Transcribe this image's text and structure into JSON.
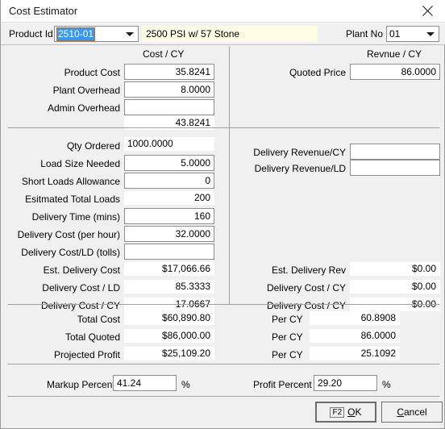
{
  "window": {
    "title": "Cost Estimator",
    "close_icon": "close-icon"
  },
  "selector": {
    "product_id_label": "Product Id",
    "product_id_value": "2510-01",
    "product_description": "2500 PSI w/ 57 Stone",
    "plant_no_label": "Plant No",
    "plant_no_value": "01",
    "dropdown_icon": "chevron-down-icon"
  },
  "cost_panel": {
    "heading": "Cost / CY",
    "rows": [
      {
        "label": "Product Cost",
        "value": "35.8241",
        "readonly": false
      },
      {
        "label": "Plant Overhead",
        "value": "8.0000",
        "readonly": false
      },
      {
        "label": "Admin Overhead",
        "value": "",
        "readonly": false
      },
      {
        "label": "",
        "value": "43.8241",
        "readonly": true
      }
    ]
  },
  "revenue_panel": {
    "heading": "Revnue / CY",
    "rows": [
      {
        "label": "Quoted Price",
        "value": "86.0000",
        "readonly": false
      }
    ]
  },
  "delivery_cost_panel": {
    "rows": [
      {
        "label": "Qty Ordered",
        "value": "1000.0000",
        "readonly": true,
        "align": "left"
      },
      {
        "label": "Load Size Needed",
        "value": "5.0000",
        "readonly": false,
        "align": "right"
      },
      {
        "label": "Short Loads Allowance",
        "value": "0",
        "readonly": false,
        "align": "right"
      },
      {
        "label": "Esitmated Total Loads",
        "value": "200",
        "readonly": true,
        "align": "right"
      },
      {
        "label": "Delivery Time (mins)",
        "value": "160",
        "readonly": false,
        "align": "right"
      },
      {
        "label": "Delivery Cost (per hour)",
        "value": "32.0000",
        "readonly": false,
        "align": "right"
      },
      {
        "label": "Delivery Cost/LD (tolls)",
        "value": "",
        "readonly": false,
        "align": "right"
      },
      {
        "label": "Est. Delivery Cost",
        "value": "$17,066.66",
        "readonly": true,
        "align": "right"
      },
      {
        "label": "Delivery Cost / LD",
        "value": "85.3333",
        "readonly": true,
        "align": "right"
      },
      {
        "label": "Delivery Cost / CY",
        "value": "17.0667",
        "readonly": true,
        "align": "right"
      }
    ]
  },
  "delivery_revenue_panel": {
    "inputs": [
      {
        "label": "Delivery Revenue/CY",
        "value": ""
      },
      {
        "label": "Delivery Revenue/LD",
        "value": ""
      }
    ],
    "outputs": [
      {
        "label": "Est. Delivery Rev",
        "value": "$0.00"
      },
      {
        "label": "Delivery Cost / CY",
        "value": "$0.00"
      },
      {
        "label": "Delivery Cost / CY",
        "value": "$0.00"
      }
    ]
  },
  "totals_panel": {
    "rows": [
      {
        "label": "Total Cost",
        "value": "$60,890.80",
        "per_label": "Per CY",
        "per_value": "60.8908"
      },
      {
        "label": "Total Quoted",
        "value": "$86,000.00",
        "per_label": "Per CY",
        "per_value": "86.0000"
      },
      {
        "label": "Projected Profit",
        "value": "$25,109.20",
        "per_label": "Per CY",
        "per_value": "25.1092"
      }
    ]
  },
  "percent_panel": {
    "markup_label": "Markup Percent",
    "markup_value": "41.24",
    "markup_suffix": "%",
    "profit_label": "Profit Percent",
    "profit_value": "29.20",
    "profit_suffix": "%"
  },
  "buttons": {
    "ok_key": "F2",
    "ok_first": "O",
    "ok_rest": "K",
    "cancel_first": "C",
    "cancel_rest": "ancel"
  }
}
